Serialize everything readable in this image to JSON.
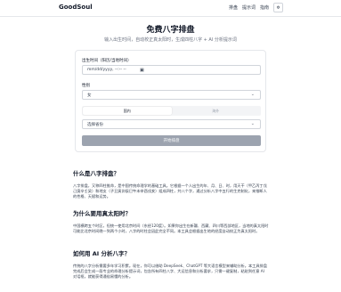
{
  "header": {
    "brand": "GoodSoul",
    "nav": [
      "排盘",
      "提示词",
      "指南"
    ],
    "theme_icon": "sun-moon-icon"
  },
  "hero": {
    "title": "免费八字排盘",
    "subtitle": "输入出生时间，自动校正真太阳时，生成四柱八字 + AI 分析提示词"
  },
  "form": {
    "birth_label": "出生时间（阳历/当地时间）",
    "birth_placeholder": "mm/dd/yyyy, --:-- --",
    "gender_label": "性别",
    "gender_value": "女",
    "region_tabs": [
      "国内",
      "海外"
    ],
    "active_region": "国内",
    "province_value": "选择省份",
    "submit_label": "开始排盘"
  },
  "sections": [
    {
      "title": "什么是八字排盘？",
      "body": "八字排盘，又称四柱推命，是中国传统命理学的基础工具。它根据一个人出生的年、月、日、时，用天干（甲乙丙丁戊己庚辛壬癸）和地支（子丑寅卯辰巳午未申酉戌亥）组成四柱，共八个字，通过分析八字中五行的生克制化，来推断人的性格、天赋和运势。"
    },
    {
      "title": "为什么要用真太阳时？",
      "body": "中国横跨五个时区，但统一使用北京时间（东经120度）。如果你出生在新疆、西藏、四川等西部地区，当地的真太阳时可能比北京时间晚一到两个小时，八字的时柱会因此完全不同。本工具会根据出生地的经度自动校正为真太阳时。"
    },
    {
      "title": "如何用 AI 分析八字？",
      "body": "传统的八字分析需要多年学习积累。现在，你可以借助 DeepSeek、ChatGPT 等大语言模型来辅助分析。本工具排盘完成后会生成一段专业的命理分析提示词，包含所有四柱八字、大运信息和分析要求，只需一键复制，粘贴到任意 AI 对话框，就能获得通俗易懂的分析。"
    }
  ]
}
